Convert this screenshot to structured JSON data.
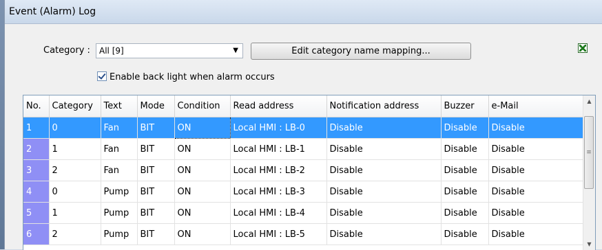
{
  "window": {
    "title": "Event (Alarm) Log"
  },
  "category": {
    "label": "Category :",
    "value": "All [9]"
  },
  "edit_button": "Edit category name mapping...",
  "backlight": {
    "label": "Enable back light when alarm occurs",
    "checked": true
  },
  "table": {
    "columns": [
      "No.",
      "Category",
      "Text",
      "Mode",
      "Condition",
      "Read address",
      "Notification address",
      "Buzzer",
      "e-Mail"
    ],
    "rows": [
      [
        "1",
        "0",
        "Fan",
        "BIT",
        "ON",
        "Local HMI : LB-0",
        "Disable",
        "Disable",
        "Disable"
      ],
      [
        "2",
        "1",
        "Fan",
        "BIT",
        "ON",
        "Local HMI : LB-1",
        "Disable",
        "Disable",
        "Disable"
      ],
      [
        "3",
        "2",
        "Fan",
        "BIT",
        "ON",
        "Local HMI : LB-2",
        "Disable",
        "Disable",
        "Disable"
      ],
      [
        "4",
        "0",
        "Pump",
        "BIT",
        "ON",
        "Local HMI : LB-3",
        "Disable",
        "Disable",
        "Disable"
      ],
      [
        "5",
        "1",
        "Pump",
        "BIT",
        "ON",
        "Local HMI : LB-4",
        "Disable",
        "Disable",
        "Disable"
      ],
      [
        "6",
        "2",
        "Pump",
        "BIT",
        "ON",
        "Local HMI : LB-5",
        "Disable",
        "Disable",
        "Disable"
      ]
    ],
    "selected_row": 0
  },
  "colors": {
    "selection": "#3399ff",
    "row_number_bg": "#8f8ff5"
  }
}
